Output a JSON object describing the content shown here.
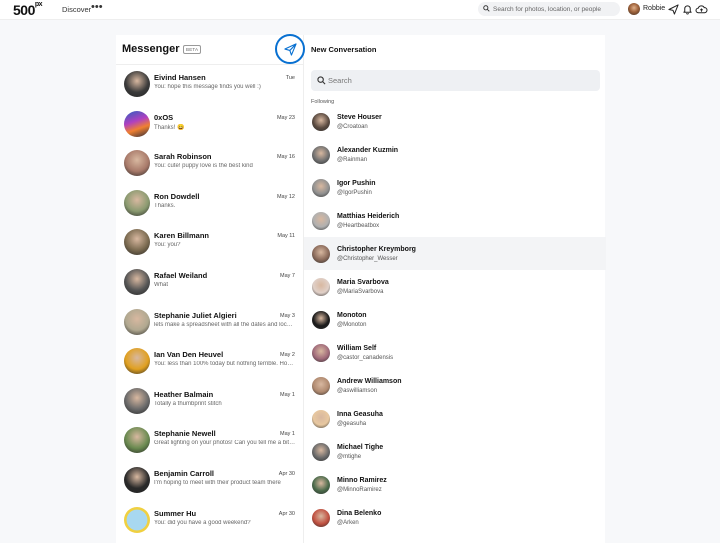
{
  "nav": {
    "logo": "500",
    "logo_sup": "px",
    "discover": "Discover",
    "more": "•••",
    "search_placeholder": "Search for photos, location, or people",
    "user_name": "Robbie"
  },
  "messenger": {
    "title": "Messenger",
    "badge": "BETA"
  },
  "new_conversation": {
    "title": "New Conversation",
    "search_placeholder": "Search",
    "following_label": "Following"
  },
  "conversations": [
    {
      "name": "Eivind Hansen",
      "date": "Tue",
      "preview": "You: hope this message finds you well :)",
      "avatar_color": "#3b3b3b"
    },
    {
      "name": "0xOS",
      "date": "May 23",
      "preview": "Thanks! 😄",
      "avatar_color": "#7a5cc8"
    },
    {
      "name": "Sarah Robinson",
      "date": "May 16",
      "preview": "You: cute! puppy love is the best kind",
      "avatar_color": "#a87a6a"
    },
    {
      "name": "Ron Dowdell",
      "date": "May 12",
      "preview": "Thanks.",
      "avatar_color": "#8a9a70"
    },
    {
      "name": "Karen Billmann",
      "date": "May 11",
      "preview": "You: you?",
      "avatar_color": "#7a6a50"
    },
    {
      "name": "Rafael Weiland",
      "date": "May 7",
      "preview": "What",
      "avatar_color": "#555555"
    },
    {
      "name": "Stephanie Juliet Algieri",
      "date": "May 3",
      "preview": "lets make a spreadsheet with all the dates and locations",
      "avatar_color": "#b0a890"
    },
    {
      "name": "Ian Van Den Heuvel",
      "date": "May 2",
      "preview": "You: less than 100% today but nothing terrible. How about you?",
      "avatar_color": "#e0a020"
    },
    {
      "name": "Heather Balmain",
      "date": "May 1",
      "preview": "Totally a thumbprint stitch",
      "avatar_color": "#6a6a6a"
    },
    {
      "name": "Stephanie Newell",
      "date": "May 1",
      "preview": "Great lighting on your photos! Can you tell me a bit more about your setup?",
      "avatar_color": "#6a8a50"
    },
    {
      "name": "Benjamin Carroll",
      "date": "Apr 30",
      "preview": "I'm hoping to meet with their product team there",
      "avatar_color": "#2a2a2a"
    },
    {
      "name": "Summer Hu",
      "date": "Apr 30",
      "preview": "You: did you have a good weekend?",
      "avatar_color": "#f0d040"
    }
  ],
  "following": [
    {
      "name": "Steve Houser",
      "handle": "@Croatoan",
      "avatar_color": "#5a4a40"
    },
    {
      "name": "Alexander Kuzmin",
      "handle": "@Rainman",
      "avatar_color": "#707070"
    },
    {
      "name": "Igor Pushin",
      "handle": "@IgorPushin",
      "avatar_color": "#909090"
    },
    {
      "name": "Matthias Heiderich",
      "handle": "@Heartbeatbox",
      "avatar_color": "#b0b0b0"
    },
    {
      "name": "Christopher Kreymborg",
      "handle": "@Christopher_Wesser",
      "avatar_color": "#8a6a5a"
    },
    {
      "name": "Maria Svarbova",
      "handle": "@MariaSvarbova",
      "avatar_color": "#e0d0c8"
    },
    {
      "name": "Monoton",
      "handle": "@Monoton",
      "avatar_color": "#1a1a1a"
    },
    {
      "name": "William Self",
      "handle": "@castor_canadensis",
      "avatar_color": "#a06a7a"
    },
    {
      "name": "Andrew Williamson",
      "handle": "@aswilliamson",
      "avatar_color": "#b08a70"
    },
    {
      "name": "Inna Geasuha",
      "handle": "@geasuha",
      "avatar_color": "#e8c8a0"
    },
    {
      "name": "Michael Tighe",
      "handle": "@mtighe",
      "avatar_color": "#6a6a6a"
    },
    {
      "name": "Minno Ramirez",
      "handle": "@MinnoRamirez",
      "avatar_color": "#4a6a4a"
    },
    {
      "name": "Dina Belenko",
      "handle": "@Arken",
      "avatar_color": "#c05040"
    }
  ],
  "colors": {
    "accent": "#0870d1",
    "background": "#f7f8fa"
  }
}
